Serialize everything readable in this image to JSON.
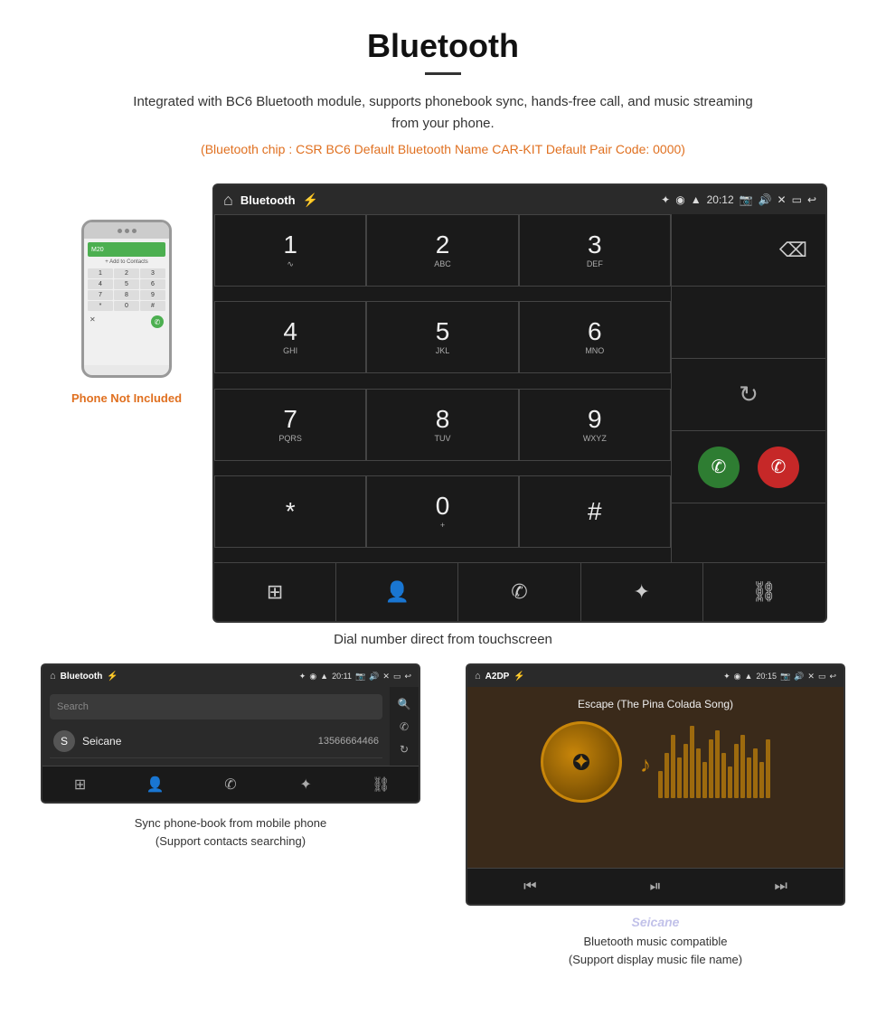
{
  "header": {
    "title": "Bluetooth",
    "description": "Integrated with BC6 Bluetooth module, supports phonebook sync, hands-free call, and music streaming from your phone.",
    "specs": "(Bluetooth chip : CSR BC6    Default Bluetooth Name CAR-KIT    Default Pair Code: 0000)"
  },
  "dial_screen": {
    "title": "Bluetooth",
    "time": "20:12",
    "keys": [
      {
        "num": "1",
        "alpha": ""
      },
      {
        "num": "2",
        "alpha": "ABC"
      },
      {
        "num": "3",
        "alpha": "DEF"
      },
      {
        "num": "4",
        "alpha": "GHI"
      },
      {
        "num": "5",
        "alpha": "JKL"
      },
      {
        "num": "6",
        "alpha": "MNO"
      },
      {
        "num": "7",
        "alpha": "PQRS"
      },
      {
        "num": "8",
        "alpha": "TUV"
      },
      {
        "num": "9",
        "alpha": "WXYZ"
      },
      {
        "num": "*",
        "alpha": ""
      },
      {
        "num": "0",
        "alpha": "+"
      },
      {
        "num": "#",
        "alpha": ""
      }
    ],
    "caption": "Dial number direct from touchscreen"
  },
  "phone_aside": {
    "not_included": "Phone Not Included"
  },
  "phonebook_screen": {
    "title": "Bluetooth",
    "time": "20:11",
    "search_placeholder": "Search",
    "contacts": [
      {
        "letter": "S",
        "name": "Seicane",
        "number": "13566664466"
      }
    ],
    "caption_line1": "Sync phone-book from mobile phone",
    "caption_line2": "(Support contacts searching)"
  },
  "music_screen": {
    "title": "A2DP",
    "time": "20:15",
    "song_title": "Escape (The Pina Colada Song)",
    "caption_line1": "Bluetooth music compatible",
    "caption_line2": "(Support display music file name)"
  },
  "equalizer_bars": [
    30,
    50,
    70,
    45,
    60,
    80,
    55,
    40,
    65,
    75,
    50,
    35,
    60,
    70,
    45,
    55,
    40,
    65
  ],
  "seicane_watermark": "Seicane"
}
